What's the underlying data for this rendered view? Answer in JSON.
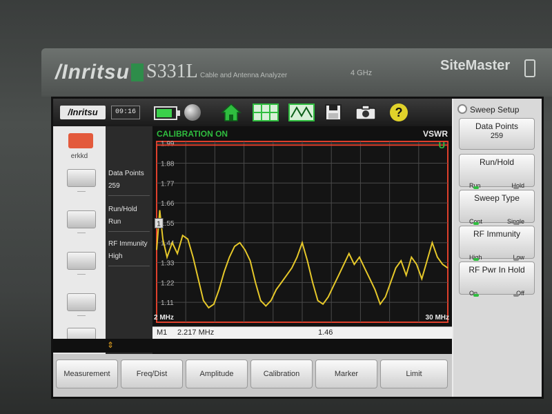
{
  "device": {
    "brand": "/Inritsu",
    "model": "S331L",
    "model_subtitle": "Cable and Antenna Analyzer",
    "ghz": "4 GHz",
    "product_line": "SiteMaster"
  },
  "header": {
    "logo": "/Inritsu",
    "clock": "09:16",
    "icons": [
      "battery-icon",
      "globe-icon",
      "home-icon",
      "grid-icon",
      "waveform-icon",
      "save-icon",
      "camera-icon",
      "help-icon"
    ],
    "help_glyph": "?"
  },
  "left_column": {
    "profile_label": "erkkd"
  },
  "summary": {
    "data_points_label": "Data Points",
    "data_points_value": "259",
    "run_hold_label": "Run/Hold",
    "run_hold_value": "Run",
    "rf_immunity_label": "RF Immunity",
    "rf_immunity_value": "High"
  },
  "plot": {
    "status": "CALIBRATION ON",
    "measurement": "VSWR",
    "limit_flag": "U",
    "start_freq": "2 MHz",
    "stop_freq": "30 MHz",
    "y_ticks": [
      "1.99",
      "1.88",
      "1.77",
      "1.66",
      "1.55",
      "1.44",
      "1.33",
      "1.22",
      "1.11"
    ],
    "marker_label": "M1",
    "marker_freq": "2.217 MHz",
    "marker_value": "1.46",
    "marker_tag": "1"
  },
  "chart_data": {
    "type": "line",
    "x_unit": "MHz",
    "xlim": [
      2,
      30
    ],
    "ylim": [
      1.0,
      2.0
    ],
    "limit_line": 1.98,
    "trace": [
      [
        2.0,
        1.4
      ],
      [
        2.3,
        1.62
      ],
      [
        2.6,
        1.46
      ],
      [
        3.0,
        1.36
      ],
      [
        3.5,
        1.44
      ],
      [
        4.0,
        1.38
      ],
      [
        4.5,
        1.48
      ],
      [
        5.0,
        1.46
      ],
      [
        5.5,
        1.36
      ],
      [
        6.0,
        1.24
      ],
      [
        6.5,
        1.12
      ],
      [
        7.0,
        1.08
      ],
      [
        7.5,
        1.1
      ],
      [
        8.0,
        1.18
      ],
      [
        8.5,
        1.28
      ],
      [
        9.0,
        1.36
      ],
      [
        9.5,
        1.42
      ],
      [
        10.0,
        1.44
      ],
      [
        10.5,
        1.4
      ],
      [
        11.0,
        1.34
      ],
      [
        11.5,
        1.22
      ],
      [
        12.0,
        1.12
      ],
      [
        12.5,
        1.09
      ],
      [
        13.0,
        1.12
      ],
      [
        13.5,
        1.18
      ],
      [
        14.0,
        1.22
      ],
      [
        14.5,
        1.26
      ],
      [
        15.0,
        1.3
      ],
      [
        15.5,
        1.36
      ],
      [
        16.0,
        1.44
      ],
      [
        16.5,
        1.34
      ],
      [
        17.0,
        1.22
      ],
      [
        17.5,
        1.12
      ],
      [
        18.0,
        1.1
      ],
      [
        18.5,
        1.14
      ],
      [
        19.0,
        1.2
      ],
      [
        19.5,
        1.26
      ],
      [
        20.0,
        1.32
      ],
      [
        20.5,
        1.38
      ],
      [
        21.0,
        1.32
      ],
      [
        21.5,
        1.36
      ],
      [
        22.0,
        1.3
      ],
      [
        22.5,
        1.24
      ],
      [
        23.0,
        1.18
      ],
      [
        23.5,
        1.1
      ],
      [
        24.0,
        1.14
      ],
      [
        24.5,
        1.22
      ],
      [
        25.0,
        1.3
      ],
      [
        25.5,
        1.34
      ],
      [
        26.0,
        1.26
      ],
      [
        26.5,
        1.36
      ],
      [
        27.0,
        1.32
      ],
      [
        27.5,
        1.24
      ],
      [
        28.0,
        1.34
      ],
      [
        28.5,
        1.44
      ],
      [
        29.0,
        1.36
      ],
      [
        29.5,
        1.32
      ],
      [
        30.0,
        1.3
      ]
    ]
  },
  "right_panel": {
    "title": "Sweep Setup",
    "buttons": [
      {
        "label": "Data Points",
        "value": "259",
        "opt_left": "",
        "opt_right": ""
      },
      {
        "label": "Run/Hold",
        "value": "",
        "opt_left": "Run",
        "opt_right": "Hold",
        "active": "left"
      },
      {
        "label": "Sweep Type",
        "value": "",
        "opt_left": "Cont",
        "opt_right": "Single",
        "active": "left"
      },
      {
        "label": "RF Immunity",
        "value": "",
        "opt_left": "High",
        "opt_right": "Low",
        "active": "left"
      },
      {
        "label": "RF Pwr In Hold",
        "value": "",
        "opt_left": "On",
        "opt_right": "Off",
        "active": "left"
      }
    ]
  },
  "tabs": [
    "Measurement",
    "Freq/Dist",
    "Amplitude",
    "Calibration",
    "Marker",
    "Limit"
  ],
  "colors": {
    "trace": "#e6c82a",
    "limit": "#e0402c",
    "grid": "#4a4a4a",
    "cal_text": "#2fbd3f"
  }
}
